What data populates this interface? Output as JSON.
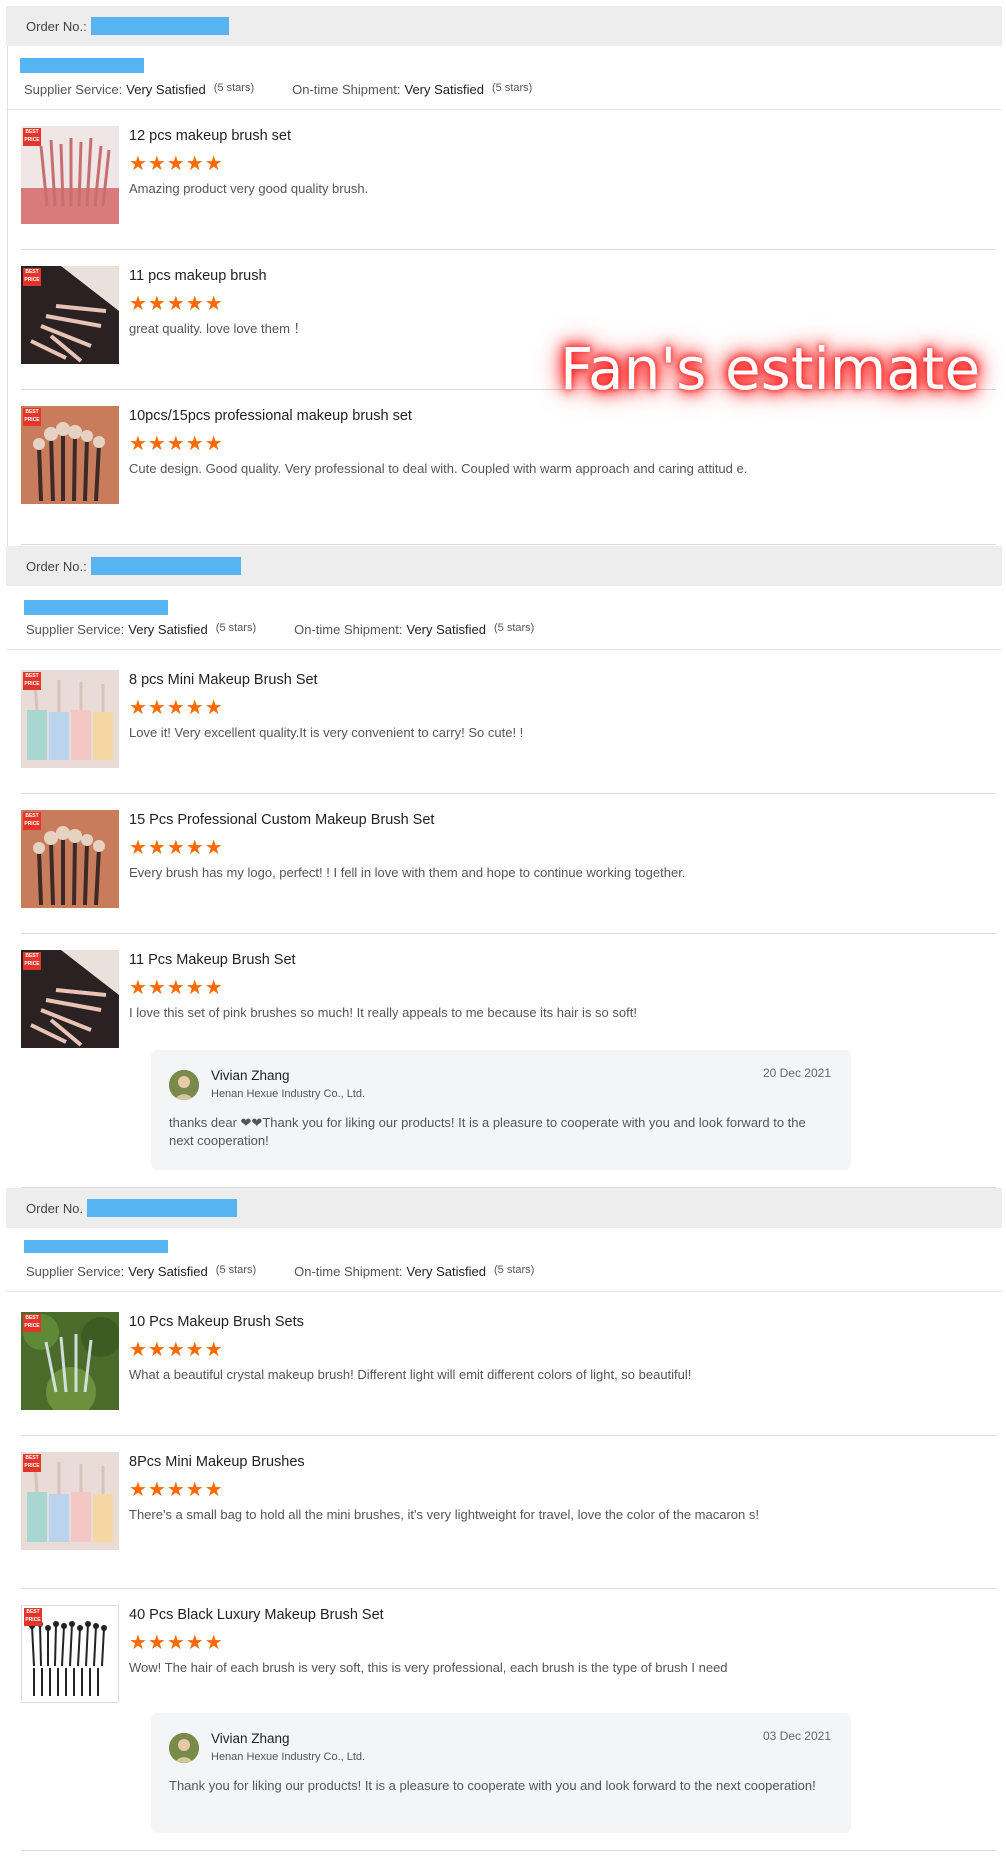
{
  "orders": [
    {
      "order_label": "Order No.:",
      "supplier_service_label": "Supplier Service:",
      "supplier_service_value": "Very Satisfied",
      "supplier_service_stars": "(5 stars)",
      "shipment_label": "On-time Shipment:",
      "shipment_value": "Very Satisfied",
      "shipment_stars": "(5 stars)",
      "items": [
        {
          "title": "12 pcs makeup brush set",
          "stars": "★★★★★",
          "comment": "Amazing product very good quality brush."
        },
        {
          "title": "11 pcs makeup brush",
          "stars": "★★★★★",
          "comment": "great quality. love love them ！"
        },
        {
          "title": "10pcs/15pcs professional makeup brush set",
          "stars": "★★★★★",
          "comment": "Cute design. Good quality. Very professional to deal with. Coupled with warm approach and caring attitud e."
        }
      ]
    },
    {
      "order_label": "Order No.:",
      "supplier_service_label": "Supplier Service:",
      "supplier_service_value": "Very Satisfied",
      "supplier_service_stars": "(5 stars)",
      "shipment_label": "On-time Shipment:",
      "shipment_value": "Very Satisfied",
      "shipment_stars": "(5 stars)",
      "items": [
        {
          "title": "8 pcs Mini Makeup Brush Set",
          "stars": "★★★★★",
          "comment": "Love it! Very excellent quality.It is very convenient to carry! So cute! !"
        },
        {
          "title": "15 Pcs Professional Custom Makeup Brush Set",
          "stars": "★★★★★",
          "comment": "Every brush has my logo, perfect! ! I fell in love with them and hope to continue working together."
        },
        {
          "title": "11 Pcs Makeup Brush Set",
          "stars": "★★★★★",
          "comment": "I love this set of pink brushes so much! It really appeals to me because its hair is so soft!"
        }
      ],
      "reply": {
        "name": "Vivian Zhang",
        "company": "Henan Hexue Industry Co., Ltd.",
        "date": "20 Dec 2021",
        "text": "thanks dear ❤❤Thank you for liking our products! It is a pleasure to cooperate with you and look forward to the next cooperation!"
      }
    },
    {
      "order_label": "Order No.",
      "supplier_service_label": "Supplier Service:",
      "supplier_service_value": "Very Satisfied",
      "supplier_service_stars": "(5 stars)",
      "shipment_label": "On-time Shipment:",
      "shipment_value": "Very Satisfied",
      "shipment_stars": "(5 stars)",
      "items": [
        {
          "title": "10 Pcs Makeup Brush Sets",
          "stars": "★★★★★",
          "comment": "What a beautiful crystal makeup brush! Different light will emit different colors of light, so beautiful!"
        },
        {
          "title": "8Pcs Mini Makeup Brushes",
          "stars": "★★★★★",
          "comment": "There's a small bag to hold all the mini brushes, it's very lightweight for travel, love the color of the macaron s!"
        },
        {
          "title": "40 Pcs Black Luxury Makeup Brush Set",
          "stars": "★★★★★",
          "comment": "Wow! The hair of each brush is very soft, this is very professional, each brush is the type of brush I need"
        }
      ],
      "reply": {
        "name": "Vivian Zhang",
        "company": "Henan Hexue Industry Co., Ltd.",
        "date": "03 Dec 2021",
        "text": "Thank you for liking our products! It is a pleasure to cooperate with you and look forward to the next cooperation!"
      }
    }
  ],
  "badge_text": "BEST PRICE",
  "watermark": "Fan's estimate",
  "colors": {
    "star": "#ff6a00",
    "redaction": "#56b4f3",
    "header_bg": "#ededed",
    "reply_bg": "#f4f5f7"
  }
}
